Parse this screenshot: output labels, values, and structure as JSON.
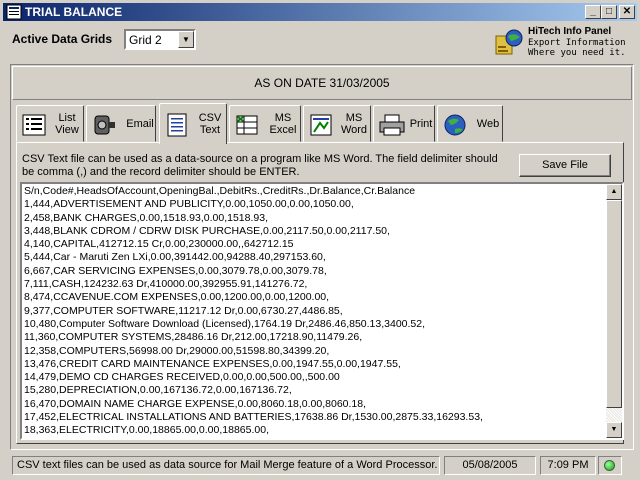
{
  "window": {
    "title": "TRIAL BALANCE",
    "controls": {
      "minimize": "_",
      "maximize": "□",
      "close": "✕"
    }
  },
  "header": {
    "grid_label": "Active Data Grids",
    "grid_value": "Grid 2",
    "hitech": {
      "title": "HiTech Info Panel",
      "line1": "Export Information",
      "line2": "Where you need it."
    }
  },
  "date_banner": "AS ON DATE 31/03/2005",
  "tabs": [
    {
      "line1": "List",
      "line2": "View",
      "icon": "list-view-icon"
    },
    {
      "line1": "Email",
      "line2": "",
      "icon": "email-icon"
    },
    {
      "line1": "CSV",
      "line2": "Text",
      "icon": "csv-text-icon",
      "active": true
    },
    {
      "line1": "MS",
      "line2": "Excel",
      "icon": "excel-icon"
    },
    {
      "line1": "MS",
      "line2": "Word",
      "icon": "word-icon"
    },
    {
      "line1": "Print",
      "line2": "",
      "icon": "printer-icon"
    },
    {
      "line1": "Web",
      "line2": "",
      "icon": "web-globe-icon"
    }
  ],
  "csv_panel": {
    "description": "CSV Text file can be used as a data-source on a program like MS Word. The field delimiter should be comma (,) and the record delimiter should be ENTER.",
    "save_button": "Save File",
    "lines": [
      "S/n,Code#,HeadsOfAccount,OpeningBal.,DebitRs.,CreditRs.,Dr.Balance,Cr.Balance",
      "1,444,ADVERTISEMENT AND PUBLICITY,0.00,1050.00,0.00,1050.00,",
      "2,458,BANK CHARGES,0.00,1518.93,0.00,1518.93,",
      "3,448,BLANK CDROM / CDRW DISK PURCHASE,0.00,2117.50,0.00,2117.50,",
      "4,140,CAPITAL,412712.15  Cr,0.00,230000.00,,642712.15",
      "5,444,Car - Maruti Zen LXi,0.00,391442.00,94288.40,297153.60,",
      "6,667,CAR SERVICING EXPENSES,0.00,3079.78,0.00,3079.78,",
      "7,111,CASH,124232.63  Dr,410000.00,392955.91,141276.72,",
      "8,474,CCAVENUE.COM EXPENSES,0.00,1200.00,0.00,1200.00,",
      "9,377,COMPUTER SOFTWARE,11217.12  Dr,0.00,6730.27,4486.85,",
      "10,480,Computer Software Download (Licensed),1764.19  Dr,2486.46,850.13,3400.52,",
      "11,360,COMPUTER SYSTEMS,28486.16  Dr,212.00,17218.90,11479.26,",
      "12,358,COMPUTERS,56998.00  Dr,29000.00,51598.80,34399.20,",
      "13,476,CREDIT CARD MAINTENANCE EXPENSES,0.00,1947.55,0.00,1947.55,",
      "14,479,DEMO CD CHARGES RECEIVED,0.00,0.00,500.00,,500.00",
      "15,280,DEPRECIATION,0.00,167136.72,0.00,167136.72,",
      "16,470,DOMAIN NAME CHARGE EXPENSE,0.00,8060.18,0.00,8060.18,",
      "17,452,ELECTRICAL INSTALLATIONS AND BATTERIES,17638.86  Dr,1530.00,2875.33,16293.53,",
      "18,363,ELECTRICITY,0.00,18865.00,0.00,18865.00,"
    ]
  },
  "status_bar": {
    "message": "CSV text files can be used as data source for Mail Merge feature of a Word Processor.",
    "date": "05/08/2005",
    "time": "7:09 PM"
  },
  "colors": {
    "face": "#d4d0c8",
    "title_start": "#0a246a",
    "title_end": "#a6caf0",
    "led": "#10a010"
  }
}
